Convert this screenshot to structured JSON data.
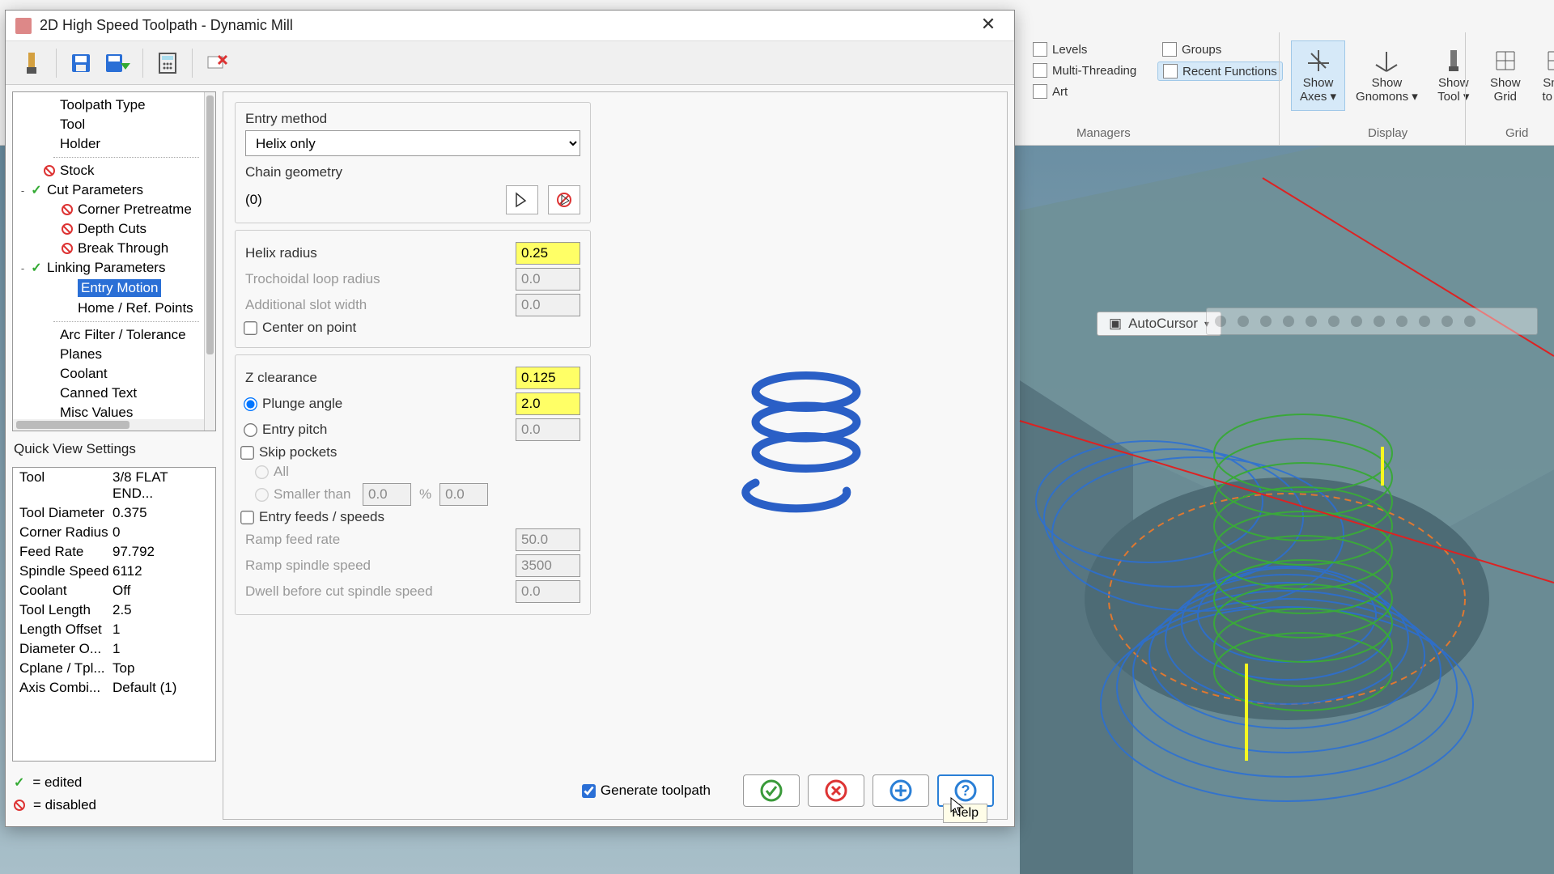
{
  "window": {
    "title": "2D High Speed Toolpath - Dynamic Mill"
  },
  "ribbon": {
    "managers_label": "Managers",
    "display_label": "Display",
    "grid_label": "Grid",
    "recent": "Recent Functions",
    "multi": "Multi-Threading",
    "art": "Art",
    "levels": "Levels",
    "groups": "Groups",
    "show_axes": "Show\nAxes ▾",
    "show_gnomons": "Show\nGnomons ▾",
    "show_tool": "Show\nTool ▾",
    "show_grid": "Show\nGrid",
    "snap_grid": "Snap\nto Gri"
  },
  "cursor_bar": {
    "autocursor": "AutoCursor"
  },
  "tree": {
    "items": [
      {
        "label": "Toolpath Type",
        "depth": 1
      },
      {
        "label": "Tool",
        "depth": 1
      },
      {
        "label": "Holder",
        "depth": 1
      },
      {
        "label": "Stock",
        "depth": 1,
        "icon": "prohibit",
        "gap_before": true
      },
      {
        "label": "Cut Parameters",
        "depth": 1,
        "expander": "-",
        "icon": "check"
      },
      {
        "label": "Corner Pretreatme",
        "depth": 2,
        "icon": "prohibit"
      },
      {
        "label": "Depth Cuts",
        "depth": 2,
        "icon": "prohibit"
      },
      {
        "label": "Break Through",
        "depth": 2,
        "icon": "prohibit"
      },
      {
        "label": "Linking Parameters",
        "depth": 1,
        "expander": "-",
        "icon": "check"
      },
      {
        "label": "Entry Motion",
        "depth": 2,
        "selected": true
      },
      {
        "label": "Home / Ref. Points",
        "depth": 2
      },
      {
        "label": "Arc Filter / Tolerance",
        "depth": 1,
        "gap_before": true
      },
      {
        "label": "Planes",
        "depth": 1
      },
      {
        "label": "Coolant",
        "depth": 1
      },
      {
        "label": "Canned Text",
        "depth": 1
      },
      {
        "label": "Misc Values",
        "depth": 1
      }
    ]
  },
  "qvs": {
    "title": "Quick View Settings",
    "rows": [
      {
        "k": "Tool",
        "v": "3/8 FLAT END..."
      },
      {
        "k": "Tool Diameter",
        "v": "0.375"
      },
      {
        "k": "Corner Radius",
        "v": "0"
      },
      {
        "k": "Feed Rate",
        "v": "97.792"
      },
      {
        "k": "Spindle Speed",
        "v": "6112"
      },
      {
        "k": "Coolant",
        "v": "Off"
      },
      {
        "k": "Tool Length",
        "v": "2.5"
      },
      {
        "k": "Length Offset",
        "v": "1"
      },
      {
        "k": "Diameter O...",
        "v": "1"
      },
      {
        "k": "Cplane / Tpl...",
        "v": "Top"
      },
      {
        "k": "Axis Combi...",
        "v": "Default (1)"
      }
    ]
  },
  "legend": {
    "edited": "= edited",
    "disabled": "= disabled"
  },
  "form": {
    "entry_method_lbl": "Entry method",
    "entry_method_val": "Helix only",
    "chain_geometry_lbl": "Chain geometry",
    "chain_count": "(0)",
    "helix_radius_lbl": "Helix radius",
    "helix_radius_val": "0.25",
    "troch_lbl": "Trochoidal loop radius",
    "troch_val": "0.0",
    "slot_lbl": "Additional slot width",
    "slot_val": "0.0",
    "center_lbl": "Center on point",
    "zclr_lbl": "Z clearance",
    "zclr_val": "0.125",
    "plunge_lbl": "Plunge angle",
    "plunge_val": "2.0",
    "pitch_lbl": "Entry pitch",
    "pitch_val": "0.0",
    "skip_lbl": "Skip pockets",
    "all_lbl": "All",
    "smaller_lbl": "Smaller than",
    "smaller_val": "0.0",
    "smaller_pct": "%",
    "smaller_abs": "0.0",
    "efs_lbl": "Entry feeds / speeds",
    "ramp_feed_lbl": "Ramp feed rate",
    "ramp_feed_val": "50.0",
    "ramp_spd_lbl": "Ramp spindle speed",
    "ramp_spd_val": "3500",
    "dwell_lbl": "Dwell before cut spindle speed",
    "dwell_val": "0.0"
  },
  "footer": {
    "generate": "Generate toolpath",
    "help_tip": "Help"
  }
}
